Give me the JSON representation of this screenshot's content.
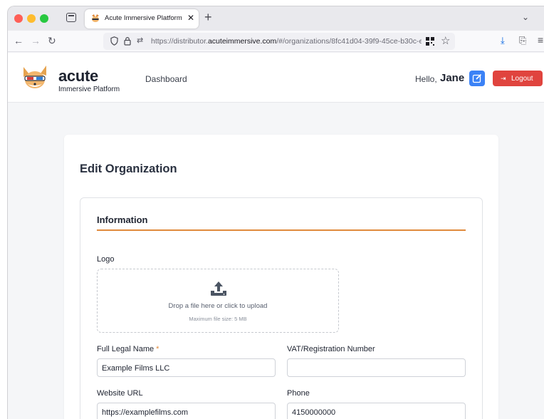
{
  "browser": {
    "tab_title": "Acute Immersive Platform",
    "url_prefix": "https://distributor.",
    "url_domain": "acuteimmersive.com",
    "url_path": "/#/organizations/8fc41d04-39f9-45ce-b30c-e"
  },
  "header": {
    "brand_name": "acute",
    "brand_subtitle": "Immersive Platform",
    "nav_dashboard": "Dashboard",
    "greeting": "Hello,",
    "user_name": "Jane",
    "logout_label": "Logout"
  },
  "page": {
    "title": "Edit Organization",
    "section_title": "Information",
    "logo_label": "Logo",
    "upload_text": "Drop a file here or click to upload",
    "upload_hint": "Maximum file size: 5 MB"
  },
  "form": {
    "legal_name_label": "Full Legal Name",
    "required_marker": "*",
    "legal_name_value": "Example Films LLC",
    "vat_label": "VAT/Registration Number",
    "vat_value": "",
    "website_label": "Website URL",
    "website_value": "https://examplefilms.com",
    "phone_label": "Phone",
    "phone_value": "4150000000"
  },
  "colors": {
    "accent_orange": "#e08a3c",
    "edit_blue": "#3b82f6",
    "logout_red": "#e0443e"
  },
  "icons": [
    "tab-overview-icon",
    "close-icon",
    "plus-icon",
    "chevron-down-icon",
    "back-icon",
    "forward-icon",
    "reload-icon",
    "shield-icon",
    "lock-icon",
    "permissions-icon",
    "qr-code-icon",
    "bookmark-star-icon",
    "download-icon",
    "share-icon",
    "menu-icon",
    "pencil-icon",
    "logout-icon",
    "upload-icon"
  ]
}
